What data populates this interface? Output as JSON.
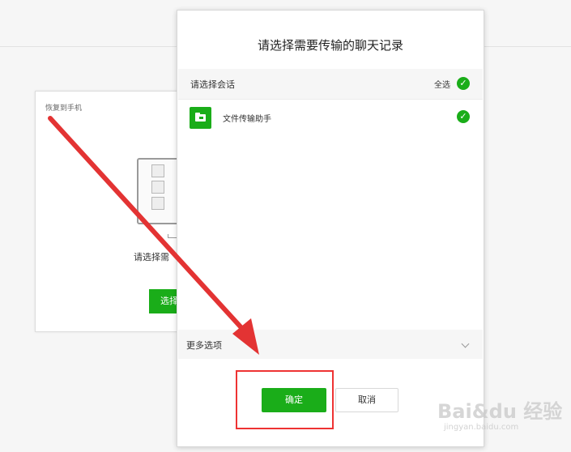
{
  "background_card": {
    "title": "恢复到手机",
    "prompt": "请选择需",
    "select_button": "选择"
  },
  "dialog": {
    "title": "请选择需要传输的聊天记录",
    "section_label": "请选择会话",
    "select_all_label": "全选",
    "chats": [
      {
        "name": "文件传输助手",
        "checked": true
      }
    ],
    "more_options_label": "更多选项",
    "confirm_label": "确定",
    "cancel_label": "取消"
  },
  "watermark": {
    "brand": "Bai&du 经验",
    "url": "jingyan.baidu.com"
  },
  "colors": {
    "accent_green": "#1aad19",
    "annotation_red": "#e33333"
  },
  "icons": {
    "check": "check-circle-icon",
    "folder": "folder-icon",
    "chevron": "chevron-down-icon",
    "monitor": "monitor-icon"
  }
}
